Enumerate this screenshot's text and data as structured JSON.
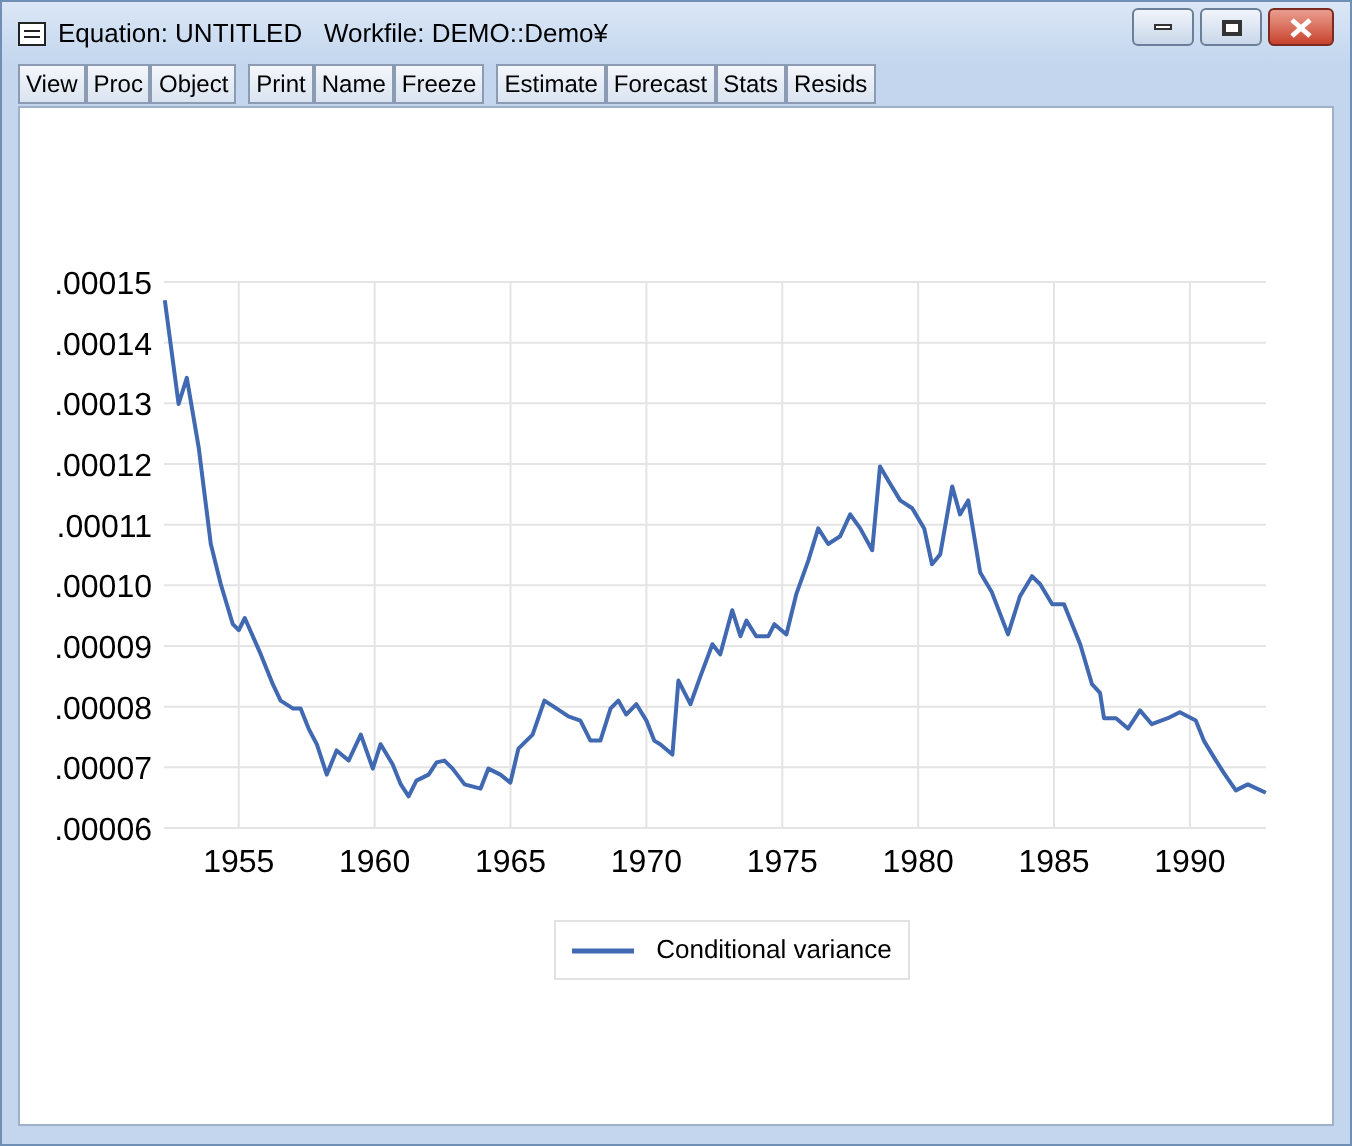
{
  "window": {
    "title": "Equation: UNTITLED   Workfile: DEMO::Demo¥"
  },
  "toolbar": {
    "groups": [
      [
        "View",
        "Proc",
        "Object"
      ],
      [
        "Print",
        "Name",
        "Freeze"
      ],
      [
        "Estimate",
        "Forecast",
        "Stats",
        "Resids"
      ]
    ]
  },
  "chart": {
    "chart_data": {
      "type": "line",
      "grid": true,
      "xlim": [
        1952.25,
        1992.8
      ],
      "ylim": [
        6e-05,
        0.00015
      ],
      "xticks": [
        1955,
        1960,
        1965,
        1970,
        1975,
        1980,
        1985,
        1990
      ],
      "yticks": [
        {
          "value": 6e-05,
          "label": ".00006"
        },
        {
          "value": 7e-05,
          "label": ".00007"
        },
        {
          "value": 8e-05,
          "label": ".00008"
        },
        {
          "value": 9e-05,
          "label": ".00009"
        },
        {
          "value": 0.0001,
          "label": ".00010"
        },
        {
          "value": 0.00011,
          "label": ".00011"
        },
        {
          "value": 0.00012,
          "label": ".00012"
        },
        {
          "value": 0.00013,
          "label": ".00013"
        },
        {
          "value": 0.00014,
          "label": ".00014"
        },
        {
          "value": 0.00015,
          "label": ".00015"
        }
      ],
      "x": [
        1952.28,
        1952.79,
        1953.09,
        1953.53,
        1953.97,
        1954.34,
        1954.78,
        1955.0,
        1955.22,
        1955.81,
        1956.25,
        1956.54,
        1956.99,
        1957.28,
        1957.57,
        1957.87,
        1958.24,
        1958.6,
        1959.04,
        1959.49,
        1959.93,
        1960.22,
        1960.66,
        1960.96,
        1961.25,
        1961.54,
        1961.99,
        1962.28,
        1962.57,
        1962.87,
        1963.31,
        1963.9,
        1964.19,
        1964.63,
        1965.0,
        1965.29,
        1965.81,
        1966.25,
        1966.69,
        1967.13,
        1967.57,
        1967.94,
        1968.31,
        1968.68,
        1968.97,
        1969.26,
        1969.63,
        1970.0,
        1970.29,
        1970.51,
        1970.96,
        1971.18,
        1971.62,
        1971.99,
        1972.43,
        1972.72,
        1973.16,
        1973.46,
        1973.68,
        1974.04,
        1974.49,
        1974.71,
        1975.15,
        1975.51,
        1975.96,
        1976.32,
        1976.69,
        1977.13,
        1977.5,
        1977.87,
        1978.31,
        1978.6,
        1978.9,
        1979.34,
        1979.78,
        1980.22,
        1980.51,
        1980.81,
        1981.25,
        1981.54,
        1981.84,
        1982.28,
        1982.72,
        1983.31,
        1983.75,
        1984.19,
        1984.49,
        1984.93,
        1985.37,
        1985.96,
        1986.4,
        1986.69,
        1986.84,
        1987.28,
        1987.72,
        1988.16,
        1988.6,
        1989.19,
        1989.63,
        1990.22,
        1990.51,
        1990.96,
        1991.25,
        1991.69,
        1992.13,
        1992.79
      ],
      "series": [
        {
          "name": "Conditional variance",
          "color": "#4169b2",
          "values": [
            0.000147,
            0.0001299,
            0.0001342,
            0.0001226,
            0.0001068,
            0.0001002,
            9.36e-05,
            9.26e-05,
            9.46e-05,
            8.86e-05,
            8.37e-05,
            8.1e-05,
            7.97e-05,
            7.97e-05,
            7.64e-05,
            7.38e-05,
            6.88e-05,
            7.28e-05,
            7.11e-05,
            7.54e-05,
            6.98e-05,
            7.38e-05,
            7.05e-05,
            6.72e-05,
            6.52e-05,
            6.78e-05,
            6.88e-05,
            7.08e-05,
            7.11e-05,
            6.98e-05,
            6.72e-05,
            6.65e-05,
            6.98e-05,
            6.88e-05,
            6.75e-05,
            7.31e-05,
            7.54e-05,
            8.1e-05,
            7.97e-05,
            7.84e-05,
            7.77e-05,
            7.44e-05,
            7.44e-05,
            7.97e-05,
            8.1e-05,
            7.87e-05,
            8.04e-05,
            7.77e-05,
            7.44e-05,
            7.38e-05,
            7.21e-05,
            8.43e-05,
            8.04e-05,
            8.5e-05,
            9.03e-05,
            8.86e-05,
            9.59e-05,
            9.16e-05,
            9.42e-05,
            9.16e-05,
            9.16e-05,
            9.36e-05,
            9.19e-05,
            9.85e-05,
            0.0001041,
            0.0001094,
            0.0001068,
            0.0001081,
            0.0001117,
            0.0001094,
            0.0001058,
            0.0001196,
            0.0001173,
            0.000114,
            0.0001127,
            0.0001094,
            0.0001035,
            0.0001051,
            0.0001163,
            0.0001117,
            0.000114,
            0.0001021,
            9.88e-05,
            9.19e-05,
            9.82e-05,
            0.0001015,
            0.0001002,
            9.69e-05,
            9.69e-05,
            9.03e-05,
            8.37e-05,
            8.23e-05,
            7.81e-05,
            7.81e-05,
            7.64e-05,
            7.94e-05,
            7.71e-05,
            7.81e-05,
            7.91e-05,
            7.77e-05,
            7.44e-05,
            7.11e-05,
            6.91e-05,
            6.62e-05,
            6.72e-05,
            6.58e-05
          ]
        }
      ]
    }
  }
}
